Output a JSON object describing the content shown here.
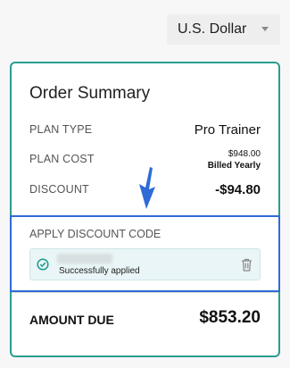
{
  "currency": {
    "selected": "U.S. Dollar"
  },
  "order_summary": {
    "title": "Order Summary",
    "plan_type": {
      "label": "PLAN TYPE",
      "value": "Pro Trainer"
    },
    "plan_cost": {
      "label": "PLAN COST",
      "price": "$948.00",
      "billing": "Billed Yearly"
    },
    "discount": {
      "label": "DISCOUNT",
      "value": "-$94.80"
    },
    "discount_code": {
      "label": "APPLY DISCOUNT CODE",
      "status_text": "Successfully applied",
      "status_icon": "check-circle-icon",
      "remove_icon": "trash-icon"
    },
    "amount_due": {
      "label": "AMOUNT DUE",
      "value": "$853.20"
    }
  },
  "colors": {
    "card_border": "#2a9d8f",
    "highlight_border": "#2f6bd6",
    "success_icon": "#1a9a8a",
    "applied_background": "#e9f5f6",
    "annotation_arrow": "#2f6bd6"
  }
}
